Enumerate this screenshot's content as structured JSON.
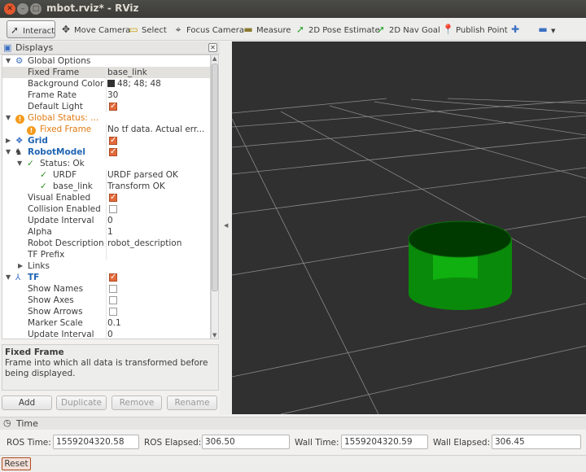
{
  "window": {
    "title": "mbot.rviz* - RViz"
  },
  "toolbar": {
    "interact": "Interact",
    "move_camera": "Move Camera",
    "select": "Select",
    "focus_camera": "Focus Camera",
    "measure": "Measure",
    "pose_estimate": "2D Pose Estimate",
    "nav_goal": "2D Nav Goal",
    "publish_point": "Publish Point"
  },
  "displays": {
    "title": "Displays",
    "rows": {
      "global_options": "Global Options",
      "fixed_frame": "Fixed Frame",
      "fixed_frame_val": "base_link",
      "bg_color": "Background Color",
      "bg_color_val": "48; 48; 48",
      "frame_rate": "Frame Rate",
      "frame_rate_val": "30",
      "default_light": "Default Light",
      "global_status": "Global Status: ...",
      "gs_fixed_frame": "Fixed Frame",
      "gs_fixed_frame_val": "No tf data.  Actual err...",
      "grid": "Grid",
      "robot_model": "RobotModel",
      "status_ok": "Status: Ok",
      "urdf": "URDF",
      "urdf_val": "URDF parsed OK",
      "base_link": "base_link",
      "base_link_val": "Transform OK",
      "visual_enabled": "Visual Enabled",
      "collision_enabled": "Collision Enabled",
      "update_interval": "Update Interval",
      "update_interval_val": "0",
      "alpha": "Alpha",
      "alpha_val": "1",
      "robot_description": "Robot Description",
      "robot_description_val": "robot_description",
      "tf_prefix": "TF Prefix",
      "links": "Links",
      "tf": "TF",
      "show_names": "Show Names",
      "show_axes": "Show Axes",
      "show_arrows": "Show Arrows",
      "marker_scale": "Marker Scale",
      "marker_scale_val": "0.1",
      "tf_update_interval": "Update Interval",
      "tf_update_interval_val": "0"
    },
    "description": {
      "title": "Fixed Frame",
      "text": "Frame into which all data is transformed before being displayed."
    },
    "buttons": {
      "add": "Add",
      "duplicate": "Duplicate",
      "remove": "Remove",
      "rename": "Rename"
    }
  },
  "time": {
    "title": "Time",
    "ros_time_label": "ROS Time:",
    "ros_time": "1559204320.58",
    "ros_elapsed_label": "ROS Elapsed:",
    "ros_elapsed": "306.50",
    "wall_time_label": "Wall Time:",
    "wall_time": "1559204320.59",
    "wall_elapsed_label": "Wall Elapsed:",
    "wall_elapsed": "306.45"
  },
  "reset": "Reset",
  "colors": {
    "background": "#303030",
    "robot": "#00a000",
    "checkbox": "#e26a3b",
    "status_warn": "#e07a10",
    "display_name": "#1f64b3"
  }
}
